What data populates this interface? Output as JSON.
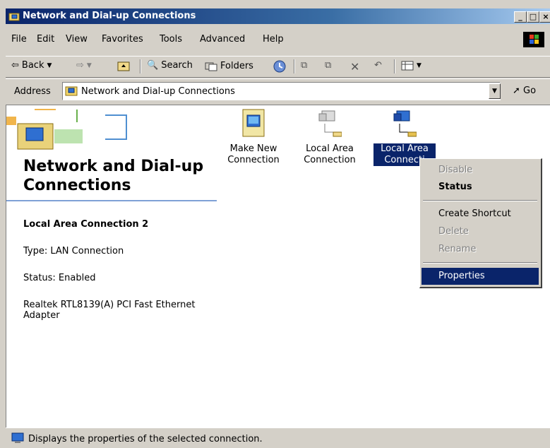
{
  "window": {
    "title": "Network and Dial-up Connections",
    "caption_buttons": [
      "minimize",
      "maximize",
      "close"
    ]
  },
  "menu": [
    "File",
    "Edit",
    "View",
    "Favorites",
    "Tools",
    "Advanced",
    "Help"
  ],
  "toolbar": {
    "back": "Back",
    "search": "Search",
    "folders": "Folders"
  },
  "address": {
    "label": "Address",
    "value": "Network and Dial-up Connections",
    "go": "Go"
  },
  "panel": {
    "title": "Network and Dial-up Connections",
    "selected_name": "Local Area Connection 2",
    "type": "Type: LAN Connection",
    "status": "Status: Enabled",
    "adapter": "Realtek RTL8139(A) PCI Fast Ethernet Adapter"
  },
  "icons": [
    {
      "label": "Make New Connection",
      "icon": "make-new-connection-icon"
    },
    {
      "label": "Local Area Connection",
      "icon": "network-connection-icon"
    },
    {
      "label": "Local Area Connecti",
      "icon": "network-connection-icon",
      "selected": true
    }
  ],
  "context_menu": {
    "disable": "Disable",
    "status": "Status",
    "create_shortcut": "Create Shortcut",
    "delete": "Delete",
    "rename": "Rename",
    "properties": "Properties"
  },
  "statusbar": {
    "text": "Displays the properties of the selected connection."
  },
  "colors": {
    "title_start": "#0a246a",
    "title_end": "#a6caf0",
    "selection": "#0a246a",
    "chrome": "#d4d0c8"
  }
}
